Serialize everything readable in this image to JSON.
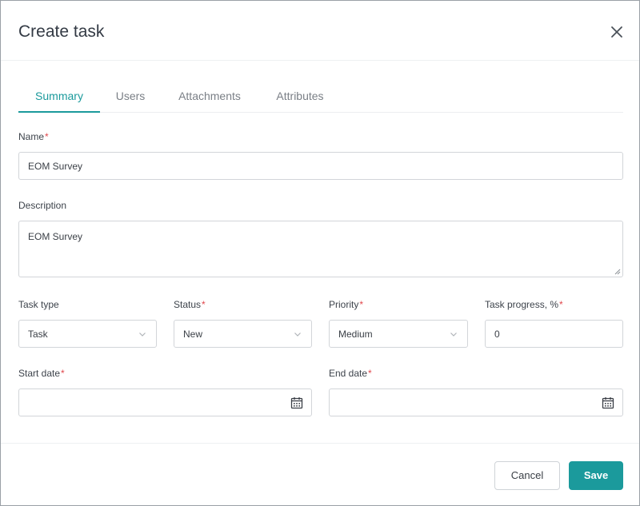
{
  "dialog": {
    "title": "Create task",
    "close_icon": "close-icon"
  },
  "tabs": [
    {
      "label": "Summary",
      "active": true
    },
    {
      "label": "Users",
      "active": false
    },
    {
      "label": "Attachments",
      "active": false
    },
    {
      "label": "Attributes",
      "active": false
    }
  ],
  "form": {
    "name": {
      "label": "Name",
      "required": "*",
      "value": "EOM Survey"
    },
    "description": {
      "label": "Description",
      "value": "EOM Survey"
    },
    "task_type": {
      "label": "Task type",
      "value": "Task",
      "icon": "chevron-down-icon"
    },
    "status": {
      "label": "Status",
      "required": "*",
      "value": "New",
      "icon": "chevron-down-icon"
    },
    "priority": {
      "label": "Priority",
      "required": "*",
      "value": "Medium",
      "icon": "chevron-down-icon"
    },
    "progress": {
      "label": "Task progress, %",
      "required": "*",
      "value": "0"
    },
    "start_date": {
      "label": "Start date",
      "required": "*",
      "value": "",
      "icon": "calendar-icon"
    },
    "end_date": {
      "label": "End date",
      "required": "*",
      "value": "",
      "icon": "calendar-icon"
    }
  },
  "footer": {
    "cancel_label": "Cancel",
    "save_label": "Save"
  },
  "colors": {
    "accent": "#1b9a9c",
    "required": "#e0474c"
  }
}
